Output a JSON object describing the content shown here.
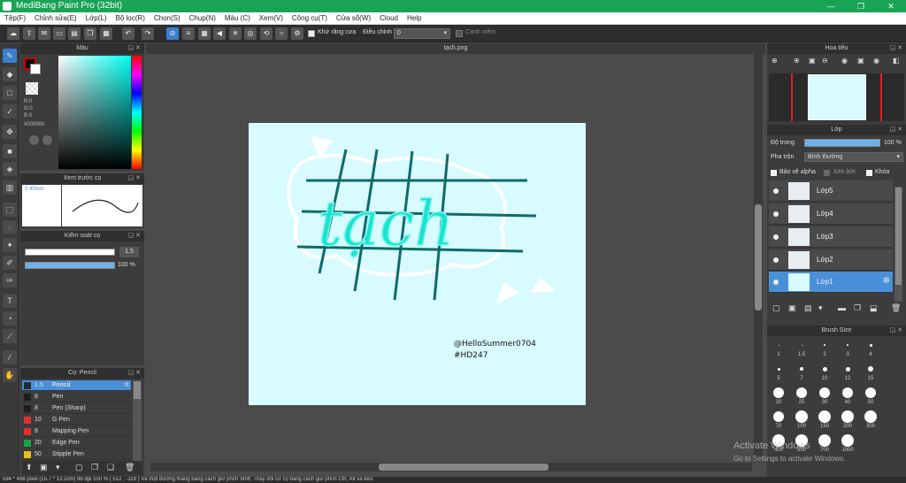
{
  "app": {
    "title": "MediBang Paint Pro (32bit)"
  },
  "window_controls": {
    "minimize": "—",
    "maximize": "❐",
    "close": "✕"
  },
  "menu": [
    "Tệp(F)",
    "Chỉnh sửa(E)",
    "Lớp(L)",
    "Bộ lọc(R)",
    "Chọn(S)",
    "Chụp(N)",
    "Màu (C)",
    "Xem(V)",
    "Công cụ(T)",
    "Cửa sổ(W)",
    "Cloud",
    "Help"
  ],
  "toolbar": {
    "antialias_label": "Khử răng cưa",
    "adjust_label": "Điều chỉnh",
    "adjust_value": "0",
    "smooth_label": "Canh mềm"
  },
  "color_panel": {
    "title": "Màu",
    "r": "R:0",
    "g": "G:0",
    "b": "B:0",
    "hex": "#000000"
  },
  "brush_preview": {
    "title": "Xem trước cọ",
    "size": "0.40mm"
  },
  "brush_control": {
    "title": "Kiểm soát cọ",
    "size_value": "1.5",
    "opacity_value": "100 %"
  },
  "brush_panel": {
    "title": "Cọ: Pencil",
    "items": [
      {
        "size": "1.5",
        "name": "Pencil",
        "color": "#1e2a3a"
      },
      {
        "size": "8",
        "name": "Pen",
        "color": "#1e1e1e"
      },
      {
        "size": "8",
        "name": "Pen (Sharp)",
        "color": "#1e1e1e"
      },
      {
        "size": "10",
        "name": "G Pen",
        "color": "#e03030"
      },
      {
        "size": "8",
        "name": "Mapping Pen",
        "color": "#e03030"
      },
      {
        "size": "20",
        "name": "Edge Pen",
        "color": "#20a040"
      },
      {
        "size": "50",
        "name": "Stipple Pen",
        "color": "#e0c020"
      }
    ]
  },
  "document": {
    "tab": "tạch.png",
    "art_title": "tạch",
    "signature_line1": "@HelloSummer0704",
    "signature_line2": "#HD247"
  },
  "navigator": {
    "title": "Hoa tiêu"
  },
  "layer_panel": {
    "title": "Lớp",
    "opacity_label": "Độ trong",
    "opacity_value": "100 %",
    "blend_label": "Pha trộn",
    "blend_value": "Bình thường",
    "protect_alpha": "Bảo vệ alpha",
    "clipping": "Xén bớt",
    "lock": "Khóa",
    "layers": [
      "Lớp5",
      "Lớp4",
      "Lớp3",
      "Lớp2",
      "Lớp1"
    ]
  },
  "brush_size_panel": {
    "title": "Brush Size",
    "sizes": [
      "1",
      "1.5",
      "2",
      "3",
      "4",
      "5",
      "7",
      "10",
      "12",
      "15",
      "20",
      "25",
      "30",
      "40",
      "50",
      "70",
      "100",
      "150",
      "200",
      "300",
      "400",
      "500",
      "700",
      "1000"
    ]
  },
  "watermark": {
    "line1": "Activate Windows",
    "line2": "Go to Settings to activate Windows."
  },
  "status": "594 * 498 pixel   (15.7 * 13.2cm)   96 dpi   100 %   ( 512 , -119 )   Vẽ một đường thẳng bằng cách giữ phím Shift. Thay đổi cỡ cọ bằng cách giữ phím Ctrl, Alt và kéo.",
  "colors": {
    "accent": "#4a90d9",
    "title_green": "#19a355",
    "canvas_bg": "#d7fbff",
    "teal_grid": "#0f6a6a",
    "neon": "#19e3d0"
  }
}
